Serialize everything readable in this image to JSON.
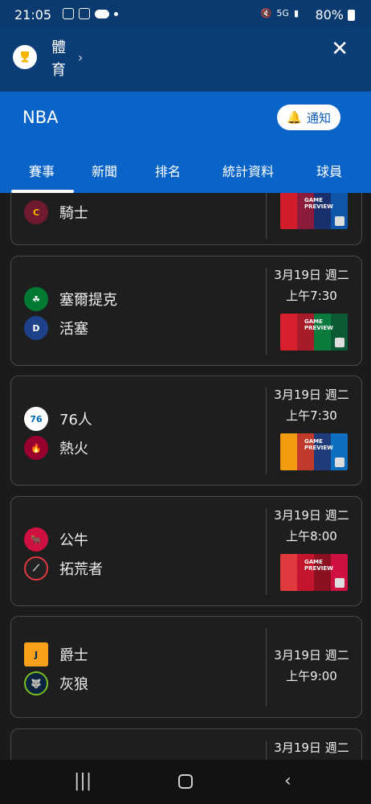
{
  "status_bar": {
    "time": "21:05",
    "battery": "80%",
    "signal_text": "5G"
  },
  "sport": {
    "label": "體\n育"
  },
  "league": {
    "name": "NBA",
    "notify_label": "通知"
  },
  "tabs": [
    {
      "label": "賽事"
    },
    {
      "label": "新聞"
    },
    {
      "label": "排名"
    },
    {
      "label": "統計資料"
    },
    {
      "label": "球員"
    }
  ],
  "games": [
    {
      "team1": "騎士",
      "team2": "",
      "date": "",
      "time": "",
      "thumb_label": "GAME\nPREVIEW"
    },
    {
      "team1": "塞爾提克",
      "team2": "活塞",
      "date": "3月19日 週二",
      "time": "上午7:30",
      "thumb_label": "GAME\nPREVIEW"
    },
    {
      "team1": "76人",
      "team2": "熱火",
      "date": "3月19日 週二",
      "time": "上午7:30",
      "thumb_label": "GAME\nPREVIEW"
    },
    {
      "team1": "公牛",
      "team2": "拓荒者",
      "date": "3月19日 週二",
      "time": "上午8:00",
      "thumb_label": "GAME\nPREVIEW"
    },
    {
      "team1": "爵士",
      "team2": "灰狼",
      "date": "3月19日 週二",
      "time": "上午9:00",
      "thumb_label": ""
    },
    {
      "team1": "",
      "team2": "",
      "date": "3月19日 週二",
      "time": "",
      "thumb_label": ""
    }
  ],
  "colors": {
    "header_dark": "#0b3d77",
    "header_blue": "#0a64c8",
    "card_border": "#4a4a4a"
  },
  "icons": {
    "trophy": "trophy-icon",
    "close": "close-icon",
    "bell": "bell-icon"
  }
}
